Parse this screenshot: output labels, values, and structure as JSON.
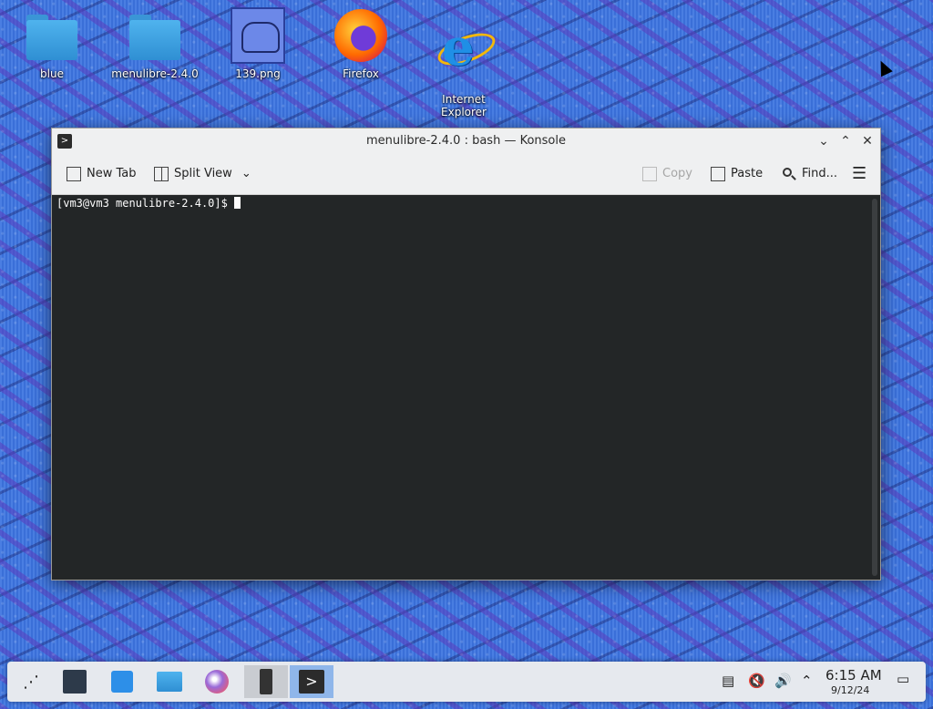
{
  "desktop": {
    "icons": [
      {
        "label": "blue"
      },
      {
        "label": "menulibre-2.4.0"
      },
      {
        "label": "139.png"
      },
      {
        "label": "Firefox"
      },
      {
        "label": "Internet\nExplorer"
      }
    ]
  },
  "window": {
    "title": "menulibre-2.4.0 : bash — Konsole",
    "toolbar": {
      "new_tab": "New Tab",
      "split_view": "Split View",
      "copy": "Copy",
      "paste": "Paste",
      "find": "Find..."
    },
    "terminal": {
      "prompt": "[vm3@vm3 menulibre-2.4.0]$ "
    }
  },
  "taskbar": {
    "clock_time": "6:15 AM",
    "clock_date": "9/12/24"
  },
  "colors": {
    "terminal_bg": "#232627",
    "taskbar_bg": "#e6e9ee"
  }
}
